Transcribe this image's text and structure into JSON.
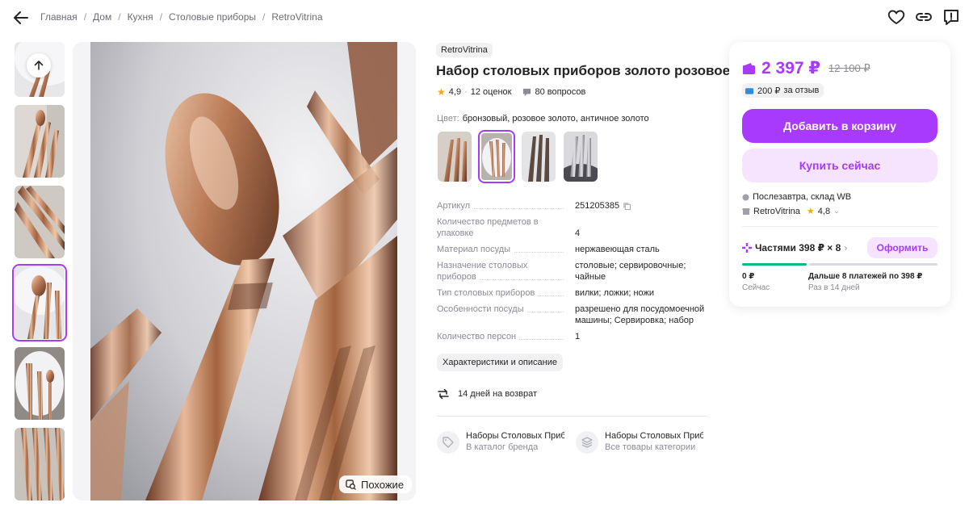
{
  "breadcrumbs": [
    "Главная",
    "Дом",
    "Кухня",
    "Столовые приборы",
    "RetroVitrina"
  ],
  "similar_label": "Похожие",
  "product": {
    "brand": "RetroVitrina",
    "title": "Набор столовых приборов золото розовое",
    "rating": "4,9",
    "reviews": "12 оценок",
    "questions": "80 вопросов",
    "color_key": "Цвет:",
    "color_value": "бронзовый, розовое золото, античное золото"
  },
  "specs": [
    {
      "k": "Артикул",
      "v": "251205385"
    },
    {
      "k": "Количество предметов в упаковке",
      "v": "4"
    },
    {
      "k": "Материал посуды",
      "v": "нержавеющая сталь"
    },
    {
      "k": "Назначение столовых приборов",
      "v": "столовые; сервировочные; чайные"
    },
    {
      "k": "Тип столовых приборов",
      "v": "вилки; ложки; ножи"
    },
    {
      "k": "Особенности посуды",
      "v": "разрешено для посудомоечной машины; Сервировка; набор"
    },
    {
      "k": "Количество персон",
      "v": "1"
    }
  ],
  "chars_button": "Характеристики и описание",
  "return_text": "14 дней на возврат",
  "cat_links": [
    {
      "t1": "Наборы Столовых Приборов",
      "t2": "В каталог бренда"
    },
    {
      "t1": "Наборы Столовых Приборов",
      "t2": "Все товары категории"
    }
  ],
  "card": {
    "price": "2 397 ₽",
    "old_price": "12 100 ₽",
    "review_bonus_amount": "200 ₽",
    "review_bonus_text": "за отзыв",
    "add_to_cart": "Добавить в корзину",
    "buy_now": "Купить сейчас",
    "delivery": "Послезавтра, склад WB",
    "seller": "RetroVitrina",
    "seller_rating": "4,8",
    "parts": "Частями 398 ₽ × 8",
    "order": "Оформить",
    "pay_now_amount": "0 ₽",
    "pay_now_label": "Сейчас",
    "pay_later_amount": "Дальше 8 платежей по 398 ₽",
    "pay_later_label": "Раз в 14 дней"
  },
  "colors": {
    "accent": "#a73afd",
    "accent_light": "#f6e3fd",
    "installment_bar": "#10b981",
    "star": "#f5a623"
  }
}
